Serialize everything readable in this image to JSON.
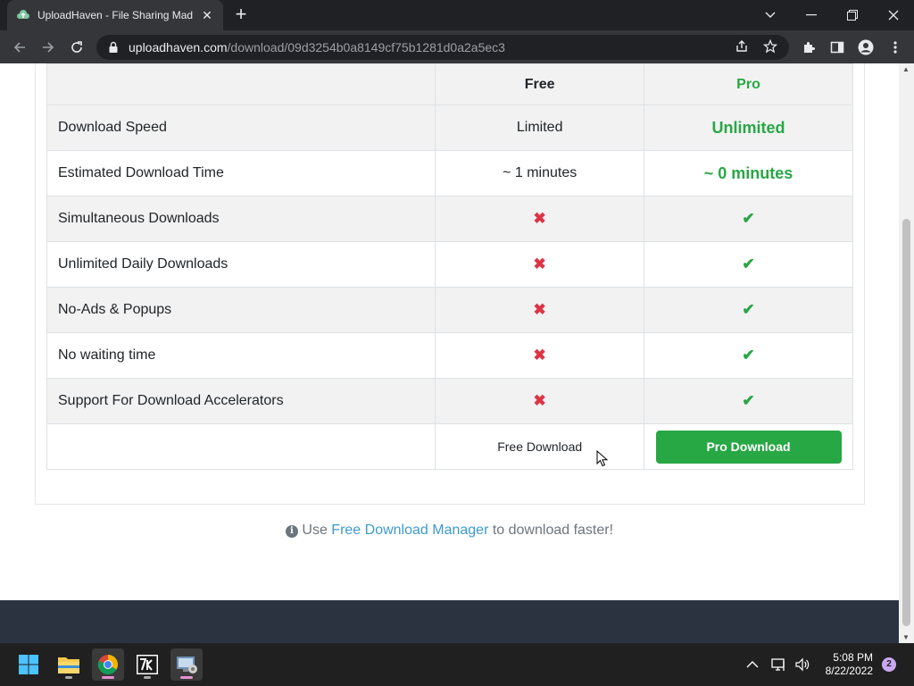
{
  "browser": {
    "tab_title": "UploadHaven - File Sharing Mad",
    "tab_close": "✕",
    "new_tab": "+",
    "url_host": "uploadhaven.com",
    "url_path": "/download/09d3254b0a8149cf75b1281d0a2a5ec3"
  },
  "table": {
    "headers": {
      "feature": "",
      "free": "Free",
      "pro": "Pro"
    },
    "rows": [
      {
        "feature": "Download Speed",
        "free": "Limited",
        "pro": "Unlimited"
      },
      {
        "feature": "Estimated Download Time",
        "free": "~ 1 minutes",
        "pro": "~ 0 minutes"
      },
      {
        "feature": "Simultaneous Downloads",
        "free": "✖",
        "pro": "✔"
      },
      {
        "feature": "Unlimited Daily Downloads",
        "free": "✖",
        "pro": "✔"
      },
      {
        "feature": "No-Ads & Popups",
        "free": "✖",
        "pro": "✔"
      },
      {
        "feature": "No waiting time",
        "free": "✖",
        "pro": "✔"
      },
      {
        "feature": "Support For Download Accelerators",
        "free": "✖",
        "pro": "✔"
      }
    ],
    "free_download_label": "Free Download",
    "pro_download_label": "Pro Download"
  },
  "tip": {
    "info_glyph": "i",
    "prefix": "Use",
    "link": "Free Download Manager",
    "suffix": "to download faster!"
  },
  "taskbar": {
    "time": "5:08 PM",
    "date": "8/22/2022",
    "notification_count": "2",
    "apps": [
      "start-icon",
      "file-explorer-icon",
      "chrome-icon",
      "7zip-icon",
      "remote-desktop-icon"
    ]
  },
  "colors": {
    "accent_green": "#28a745",
    "cross_red": "#dc3545",
    "link_blue": "#3d9ad1",
    "footer_dark": "#2c3340"
  }
}
